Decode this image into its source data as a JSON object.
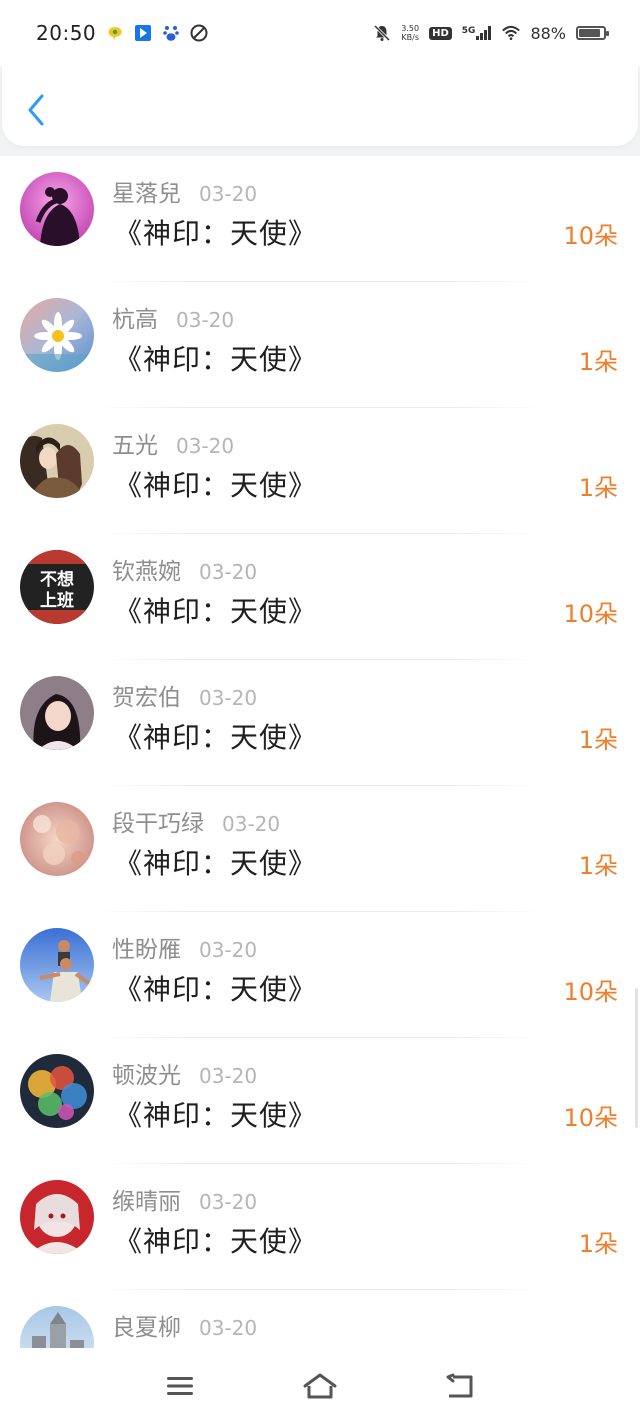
{
  "status_bar": {
    "time": "20:50",
    "net_speed_value": "3.50",
    "net_speed_unit": "KB/s",
    "hd_label": "HD",
    "network_label": "5G",
    "battery_percent": "88%",
    "battery_level": 0.88,
    "notification_icons": [
      "chat-bubble-icon",
      "blue-app-icon",
      "baidu-paw-icon",
      "leaf-app-icon"
    ]
  },
  "header": {
    "back_icon": "chevron-left-icon"
  },
  "list": {
    "items": [
      {
        "name": "星落兒",
        "date": "03-20",
        "title": "《神印：天使》",
        "gift": "10朵"
      },
      {
        "name": "杭高",
        "date": "03-20",
        "title": "《神印：天使》",
        "gift": "1朵"
      },
      {
        "name": "五光",
        "date": "03-20",
        "title": "《神印：天使》",
        "gift": "1朵"
      },
      {
        "name": "钦燕婉",
        "date": "03-20",
        "title": "《神印：天使》",
        "gift": "10朵",
        "avatar_text_1": "不想",
        "avatar_text_2": "上班"
      },
      {
        "name": "贺宏伯",
        "date": "03-20",
        "title": "《神印：天使》",
        "gift": "1朵"
      },
      {
        "name": "段干巧绿",
        "date": "03-20",
        "title": "《神印：天使》",
        "gift": "1朵"
      },
      {
        "name": "性盼雁",
        "date": "03-20",
        "title": "《神印：天使》",
        "gift": "10朵"
      },
      {
        "name": "顿波光",
        "date": "03-20",
        "title": "《神印：天使》",
        "gift": "10朵"
      },
      {
        "name": "缑晴丽",
        "date": "03-20",
        "title": "《神印：天使》",
        "gift": "1朵"
      },
      {
        "name": "良夏柳",
        "date": "03-20",
        "title": "",
        "gift": ""
      }
    ]
  },
  "colors": {
    "accent_blue": "#2a9df4",
    "gift_orange": "#ef7f2c",
    "name_gray": "#8e8e8e",
    "date_gray": "#b5b5b5"
  },
  "nav": {
    "icons": [
      "menu-icon",
      "home-icon",
      "back-return-icon"
    ]
  }
}
